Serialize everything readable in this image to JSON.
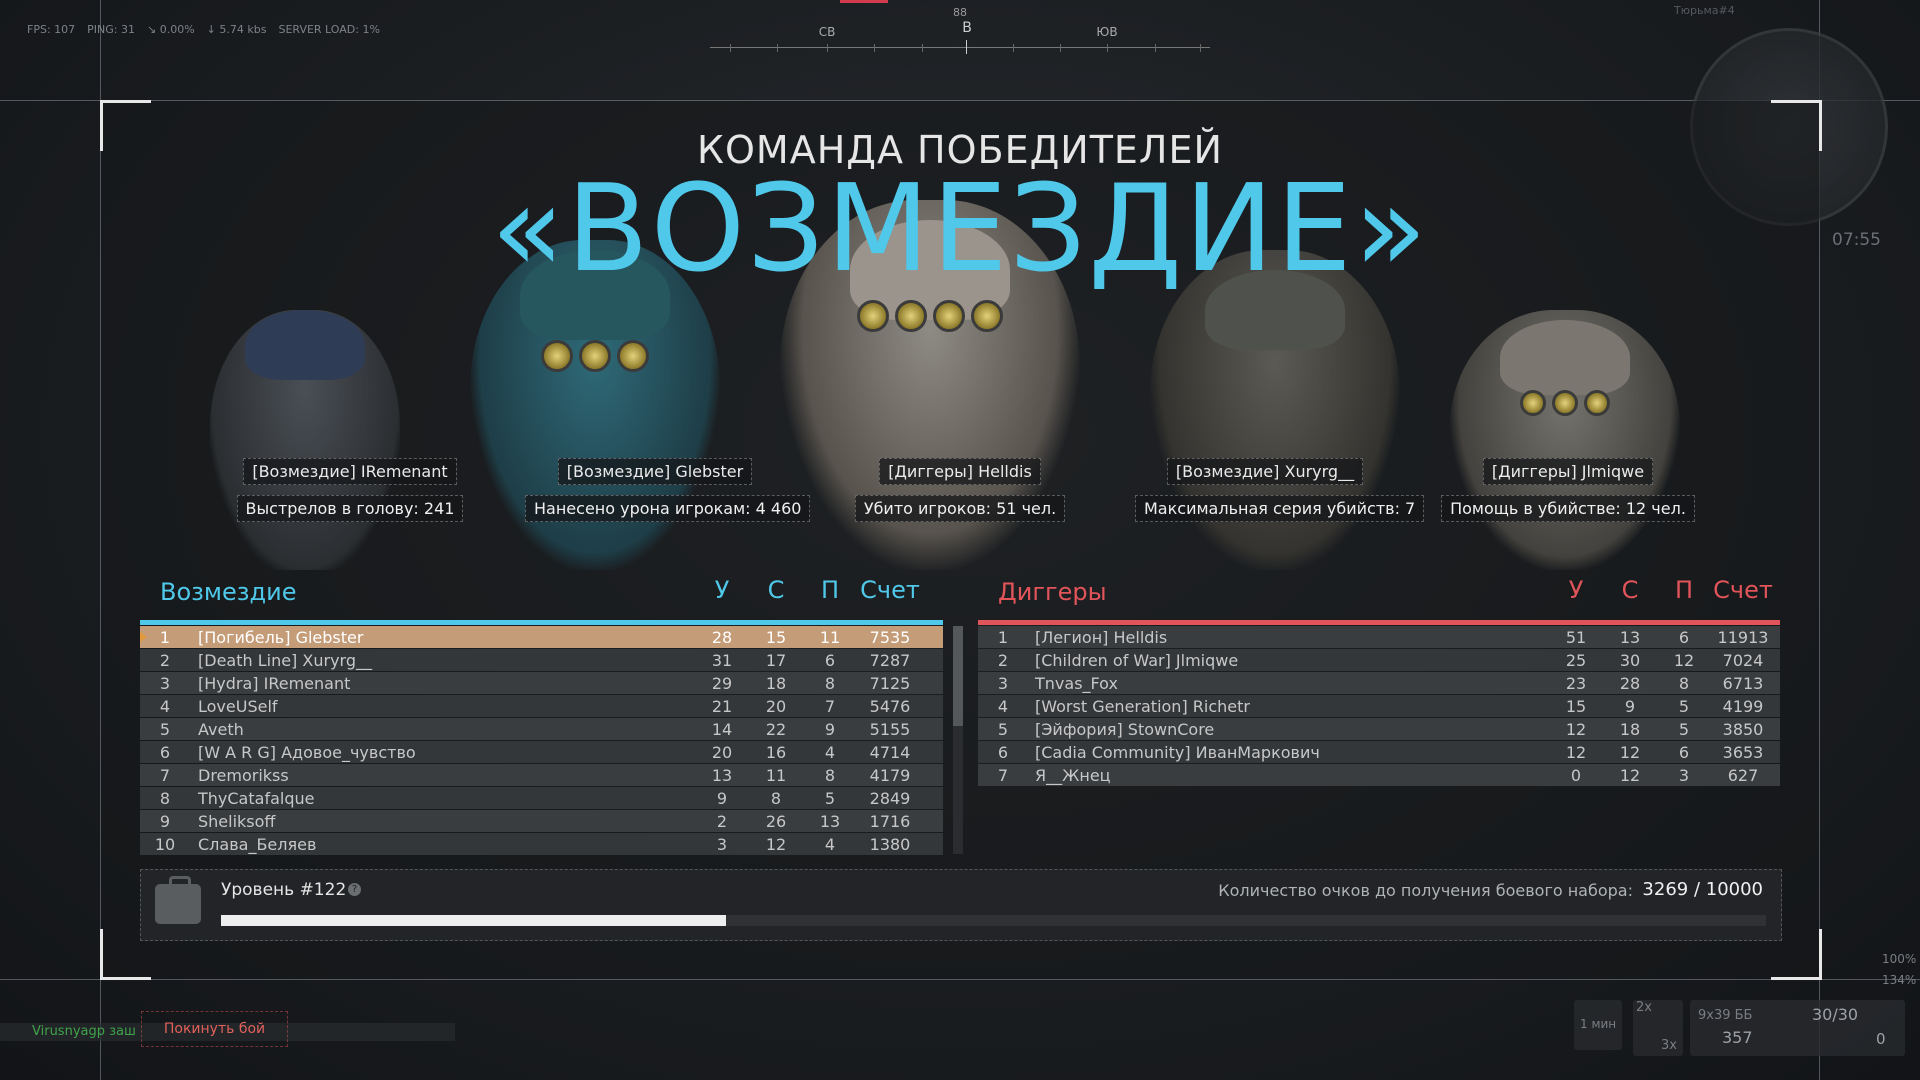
{
  "hud": {
    "fps": "FPS: 107",
    "ping": "PING: 31",
    "loss": "0.00%",
    "speed": "5.74 kbs",
    "server_load": "SERVER LOAD: 1%",
    "compass": {
      "degree": "88",
      "sw": "СВ",
      "main": "В",
      "se": "ЮВ"
    },
    "map_name": "Тюрьма#4",
    "clock": "07:55"
  },
  "header": {
    "subtitle": "КОМАНДА ПОБЕДИТЕЛЕЙ",
    "winner": "«ВОЗМЕЗДИЕ»"
  },
  "mvp": [
    {
      "name": "[Возмездие] IRemenant",
      "stat": "Выстрелов в голову: 241"
    },
    {
      "name": "[Возмездие] Glebster",
      "stat": "Нанесено урона игрокам: 4 460"
    },
    {
      "name": "[Диггеры] Helldis",
      "stat": "Убито игроков: 51 чел."
    },
    {
      "name": "[Возмездие] Xuryrg__",
      "stat": "Максимальная серия убийств: 7"
    },
    {
      "name": "[Диггеры] Jlmiqwe",
      "stat": "Помощь в убийстве: 12 чел."
    }
  ],
  "team_left": {
    "name": "Возмездие",
    "color": "#4fc8ea",
    "cols": {
      "k": "У",
      "d": "С",
      "a": "П",
      "score": "Счет"
    },
    "rows": [
      {
        "rank": "1",
        "name": "[Погибель] Glebster",
        "k": "28",
        "d": "15",
        "a": "11",
        "score": "7535"
      },
      {
        "rank": "2",
        "name": "[Death Line] Xuryrg__",
        "k": "31",
        "d": "17",
        "a": "6",
        "score": "7287"
      },
      {
        "rank": "3",
        "name": "[Hydra] IRemenant",
        "k": "29",
        "d": "18",
        "a": "8",
        "score": "7125"
      },
      {
        "rank": "4",
        "name": "LoveUSelf",
        "k": "21",
        "d": "20",
        "a": "7",
        "score": "5476"
      },
      {
        "rank": "5",
        "name": "Aveth",
        "k": "14",
        "d": "22",
        "a": "9",
        "score": "5155"
      },
      {
        "rank": "6",
        "name": "[W A R G] Адовое_чувство",
        "k": "20",
        "d": "16",
        "a": "4",
        "score": "4714"
      },
      {
        "rank": "7",
        "name": "Dremorikss",
        "k": "13",
        "d": "11",
        "a": "8",
        "score": "4179"
      },
      {
        "rank": "8",
        "name": "ThyCatafalque",
        "k": "9",
        "d": "8",
        "a": "5",
        "score": "2849"
      },
      {
        "rank": "9",
        "name": "Sheliksoff",
        "k": "2",
        "d": "26",
        "a": "13",
        "score": "1716"
      },
      {
        "rank": "10",
        "name": "Слава_Беляев",
        "k": "3",
        "d": "12",
        "a": "4",
        "score": "1380"
      }
    ]
  },
  "team_right": {
    "name": "Диггеры",
    "color": "#e0545a",
    "cols": {
      "k": "У",
      "d": "С",
      "a": "П",
      "score": "Счет"
    },
    "rows": [
      {
        "rank": "1",
        "name": "[Легион] Helldis",
        "k": "51",
        "d": "13",
        "a": "6",
        "score": "11913"
      },
      {
        "rank": "2",
        "name": "[Children of War] Jlmiqwe",
        "k": "25",
        "d": "30",
        "a": "12",
        "score": "7024"
      },
      {
        "rank": "3",
        "name": "Tnvas_Fox",
        "k": "23",
        "d": "28",
        "a": "8",
        "score": "6713"
      },
      {
        "rank": "4",
        "name": "[Worst Generation] Richetr",
        "k": "15",
        "d": "9",
        "a": "5",
        "score": "4199"
      },
      {
        "rank": "5",
        "name": "[Эйфория] StownCore",
        "k": "12",
        "d": "18",
        "a": "5",
        "score": "3850"
      },
      {
        "rank": "6",
        "name": "[Cadia Community] ИванМаркович",
        "k": "12",
        "d": "12",
        "a": "6",
        "score": "3653"
      },
      {
        "rank": "7",
        "name": "Я__Жнец",
        "k": "0",
        "d": "12",
        "a": "3",
        "score": "627"
      }
    ]
  },
  "level": {
    "label": "Уровень #122",
    "help": "?",
    "points_label": "Количество очков до получения боевого набора:",
    "points": "3269 / 10000",
    "progress": 0.3269
  },
  "bottom": {
    "leave_label": "Покинуть бой",
    "chat": "Virusnyagp заш",
    "timer": "1 мин",
    "zoom1": "2x",
    "zoom2": "3x",
    "ammo_type": "9x39 ББ",
    "ammo_mag": "30/30",
    "ammo_total": "357",
    "grenades": "0",
    "hp": "100%",
    "stamina": "134%"
  }
}
